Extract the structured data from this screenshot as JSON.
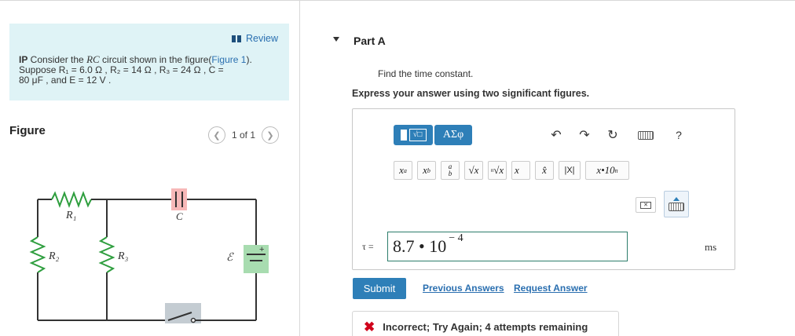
{
  "intro": {
    "review_label": "Review",
    "prefix": "IP",
    "text1": " Consider the ",
    "rc": "RC",
    "text2": " circuit shown in the figure(",
    "figure_link": "Figure 1",
    "text3": ").",
    "line2": "Suppose R₁ = 6.0 Ω , R₂ = 14 Ω , R₃ = 24 Ω , C =",
    "line3": "80 μF , and E = 12 V ."
  },
  "figure": {
    "label": "Figure",
    "pager": "1 of 1",
    "prev_icon": "chevron-left",
    "next_icon": "chevron-right",
    "labels": {
      "r1": "R₁",
      "r2": "R₂",
      "r3": "R₃",
      "c": "C",
      "e": "ℰ",
      "plus": "+"
    }
  },
  "part": {
    "title": "Part A",
    "question": "Find the time constant.",
    "instruction": "Express your answer using two significant figures."
  },
  "toolbar": {
    "template_symbol": "√□",
    "greek_label": "ΑΣφ",
    "undo_icon": "undo-arrow",
    "redo_icon": "redo-arrow",
    "reset_icon": "reset-circle",
    "keyboard_icon": "keyboard",
    "help_label": "?"
  },
  "symbols": [
    "xᵃ",
    "xₓ",
    "a/b",
    "√x",
    "ⁿ√x",
    "x⃗",
    "x̂",
    "|X|",
    "x•10ⁿ"
  ],
  "answer": {
    "variable": "τ =",
    "mantissa": "8.7 • 10",
    "exponent": "− 4",
    "unit": "ms"
  },
  "actions": {
    "submit": "Submit",
    "previous": "Previous Answers",
    "request": "Request Answer"
  },
  "feedback": {
    "icon": "✖",
    "text": "Incorrect; Try Again; 4 attempts remaining"
  },
  "colors": {
    "accent": "#2e7fb8",
    "intro_bg": "#dff3f6",
    "resistor": "#2e9e3e",
    "capacitor_bg": "#f7b8b8",
    "battery_bg": "#a8dcb0",
    "error": "#d0021b"
  }
}
